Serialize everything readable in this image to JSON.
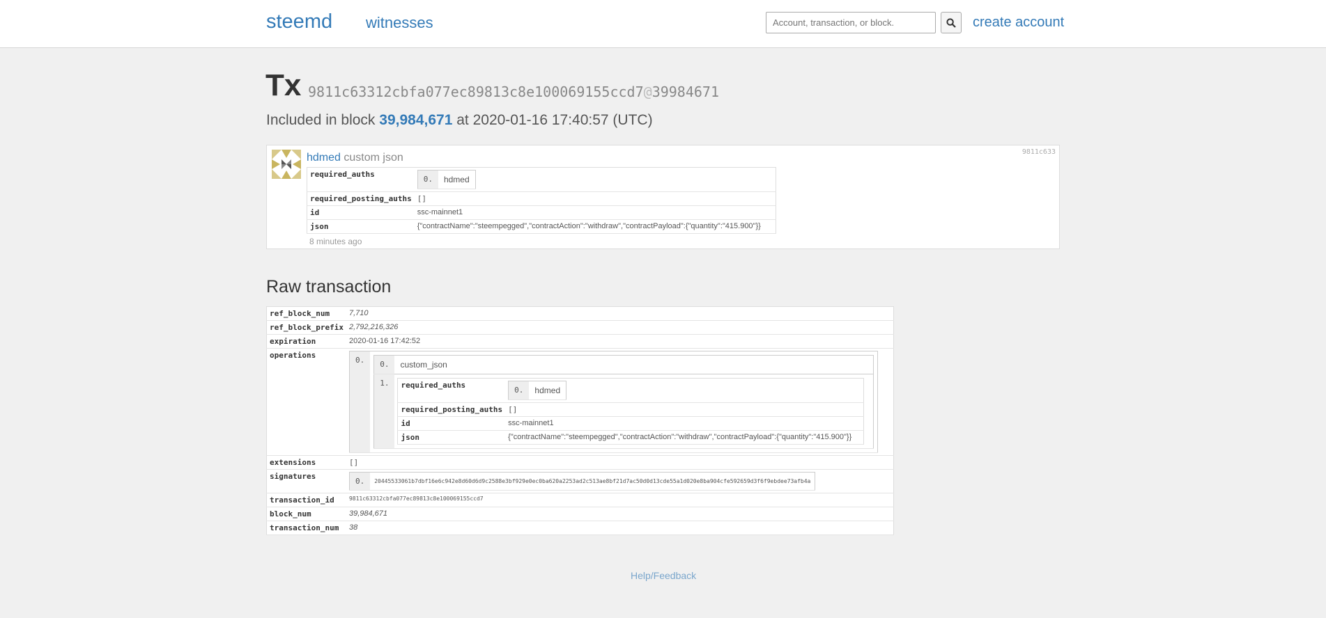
{
  "nav": {
    "brand": "steemd",
    "witnesses": "witnesses",
    "search_placeholder": "Account, transaction, or block.",
    "create_account": "create account"
  },
  "header": {
    "title": "Tx",
    "hash": "9811c63312cbfa077ec89813c8e100069155ccd7",
    "at": "@",
    "block_ref": "39984671",
    "included_prefix": "Included in block",
    "block_num": "39,984,671",
    "at_text": "at 2020-01-16 17:40:57 (UTC)"
  },
  "operation": {
    "short_id": "9811c633",
    "account": "hdmed",
    "type_label": "custom json",
    "ago": "8 minutes ago",
    "fields": {
      "required_auths_key": "required_auths",
      "required_auths_idx": "0.",
      "required_auths_val": "hdmed",
      "required_posting_auths_key": "required_posting_auths",
      "required_posting_auths_val": "[]",
      "id_key": "id",
      "id_val": "ssc-mainnet1",
      "json_key": "json",
      "json_val": "{\"contractName\":\"steempegged\",\"contractAction\":\"withdraw\",\"contractPayload\":{\"quantity\":\"415.900\"}}"
    }
  },
  "raw": {
    "title": "Raw transaction",
    "ref_block_num_key": "ref_block_num",
    "ref_block_num": "7,710",
    "ref_block_prefix_key": "ref_block_prefix",
    "ref_block_prefix": "2,792,216,326",
    "expiration_key": "expiration",
    "expiration": "2020-01-16 17:42:52",
    "operations_key": "operations",
    "op_idx": "0.",
    "op_type_idx": "0.",
    "op_type": "custom_json",
    "op_body_idx": "1.",
    "op_required_auths_key": "required_auths",
    "op_required_auths_idx": "0.",
    "op_required_auths_val": "hdmed",
    "op_required_posting_auths_key": "required_posting_auths",
    "op_required_posting_auths_val": "[]",
    "op_id_key": "id",
    "op_id_val": "ssc-mainnet1",
    "op_json_key": "json",
    "op_json_val": "{\"contractName\":\"steempegged\",\"contractAction\":\"withdraw\",\"contractPayload\":{\"quantity\":\"415.900\"}}",
    "extensions_key": "extensions",
    "extensions": "[]",
    "signatures_key": "signatures",
    "sig_idx": "0.",
    "signature": "20445533061b7dbf16e6c942e8d60d6d9c2588e3bf929e0ec0ba620a2253ad2c513ae8bf21d7ac50d0d13cde55a1d020e8ba904cfe592659d3f6f9ebdee73afb4a",
    "transaction_id_key": "transaction_id",
    "transaction_id": "9811c63312cbfa077ec89813c8e100069155ccd7",
    "block_num_key": "block_num",
    "block_num": "39,984,671",
    "transaction_num_key": "transaction_num",
    "transaction_num": "38"
  },
  "footer": {
    "help": "Help/Feedback"
  },
  "icons": {
    "search": "search-icon",
    "avatar": "identicon-avatar"
  },
  "colors": {
    "link": "#337ab7",
    "background": "#f0f0f0"
  }
}
